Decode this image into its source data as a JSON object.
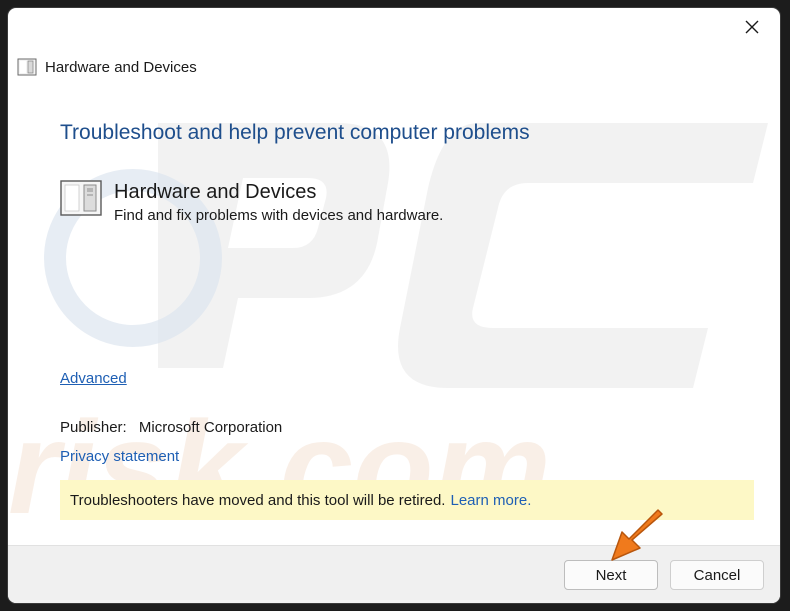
{
  "window": {
    "title": "Hardware and Devices"
  },
  "main": {
    "heading": "Troubleshoot and help prevent computer problems",
    "item_title": "Hardware and Devices",
    "item_description": "Find and fix problems with devices and hardware.",
    "advanced_link": "Advanced",
    "publisher_label": "Publisher:",
    "publisher_value": "Microsoft Corporation",
    "privacy_link": "Privacy statement",
    "notice_text": "Troubleshooters have moved and this tool will be retired.",
    "notice_link": "Learn more."
  },
  "footer": {
    "next_label": "Next",
    "cancel_label": "Cancel"
  },
  "watermark": {
    "text": "risk.com"
  },
  "colors": {
    "heading": "#1e4e8c",
    "link": "#1e5fb4",
    "notice_background": "#fdf8c6",
    "arrow": "#f07a1c"
  },
  "icons": {
    "close": "close-icon",
    "app": "hardware-devices-icon",
    "pointer": "pointer-arrow-icon"
  }
}
